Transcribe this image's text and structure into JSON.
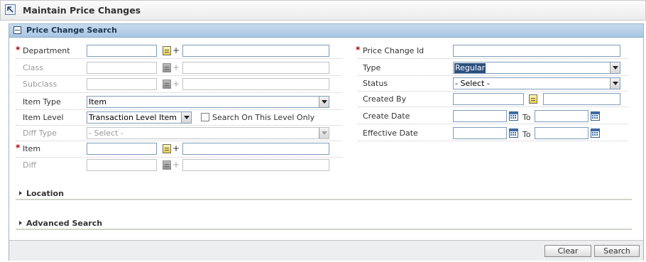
{
  "window": {
    "title": "Maintain Price Changes"
  },
  "panel": {
    "title": "Price Change Search"
  },
  "left": {
    "department": {
      "label": "Department",
      "value": "",
      "desc": ""
    },
    "class": {
      "label": "Class",
      "value": "",
      "desc": ""
    },
    "subclass": {
      "label": "Subclass",
      "value": "",
      "desc": ""
    },
    "item_type": {
      "label": "Item Type",
      "selected": "Item"
    },
    "item_level": {
      "label": "Item Level",
      "selected": "Transaction Level Item",
      "checkbox_label": "Search On This Level Only",
      "checked": false
    },
    "diff_type": {
      "label": "Diff Type",
      "selected": "- Select -"
    },
    "item": {
      "label": "Item",
      "value": "",
      "desc": ""
    },
    "diff": {
      "label": "Diff",
      "value": "",
      "desc": ""
    },
    "plus": "+"
  },
  "right": {
    "price_change_id": {
      "label": "Price Change Id",
      "value": ""
    },
    "type": {
      "label": "Type",
      "selected": "Regular"
    },
    "status": {
      "label": "Status",
      "selected": "- Select -"
    },
    "created_by": {
      "label": "Created By",
      "value": "",
      "desc": ""
    },
    "create_date": {
      "label": "Create Date",
      "from": "",
      "to_label": "To",
      "to": ""
    },
    "effective_date": {
      "label": "Effective Date",
      "from": "",
      "to_label": "To",
      "to": ""
    }
  },
  "sections": {
    "location": "Location",
    "advanced": "Advanced Search"
  },
  "buttons": {
    "clear": "Clear",
    "search": "Search"
  },
  "required_marker": "*"
}
